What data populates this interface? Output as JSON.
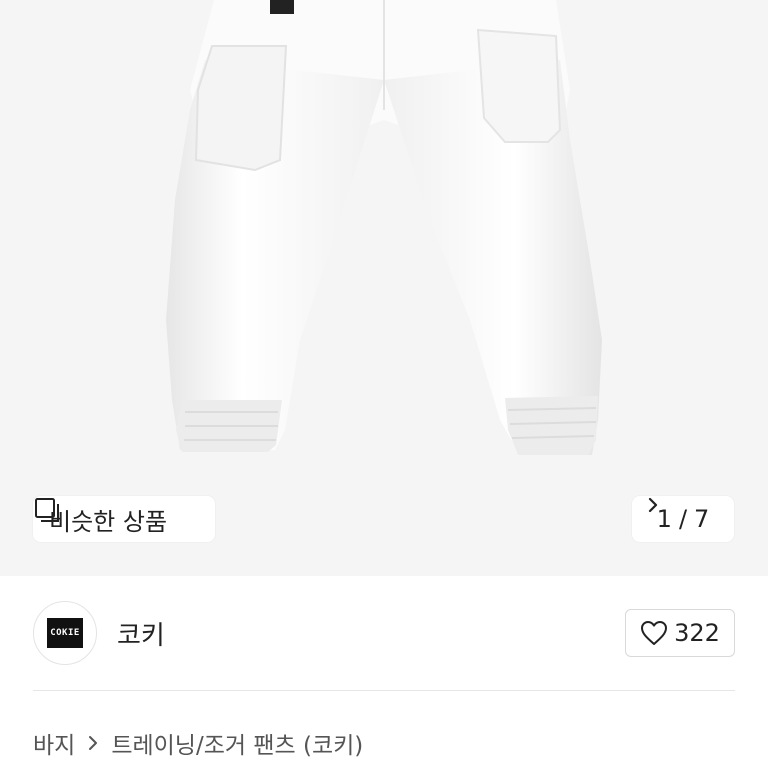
{
  "similar_products": {
    "label": "비슷한 상품"
  },
  "image_counter": {
    "current": "1",
    "separator": "/",
    "total": "7"
  },
  "seller": {
    "name": "코키",
    "logo_text": "COKIE"
  },
  "likes": {
    "count": "322"
  },
  "breadcrumb": {
    "items": [
      "바지",
      "트레이닝/조거 팬츠 (코키)"
    ]
  },
  "colors": {
    "hero_bg": "#f5f5f5",
    "text": "#222222",
    "border": "#d9d9d9"
  },
  "icons": {
    "similar": "copy-square-icon",
    "next": "chevron-right-icon",
    "like": "heart-outline-icon",
    "breadcrumb_sep": "chevron-right-icon"
  }
}
